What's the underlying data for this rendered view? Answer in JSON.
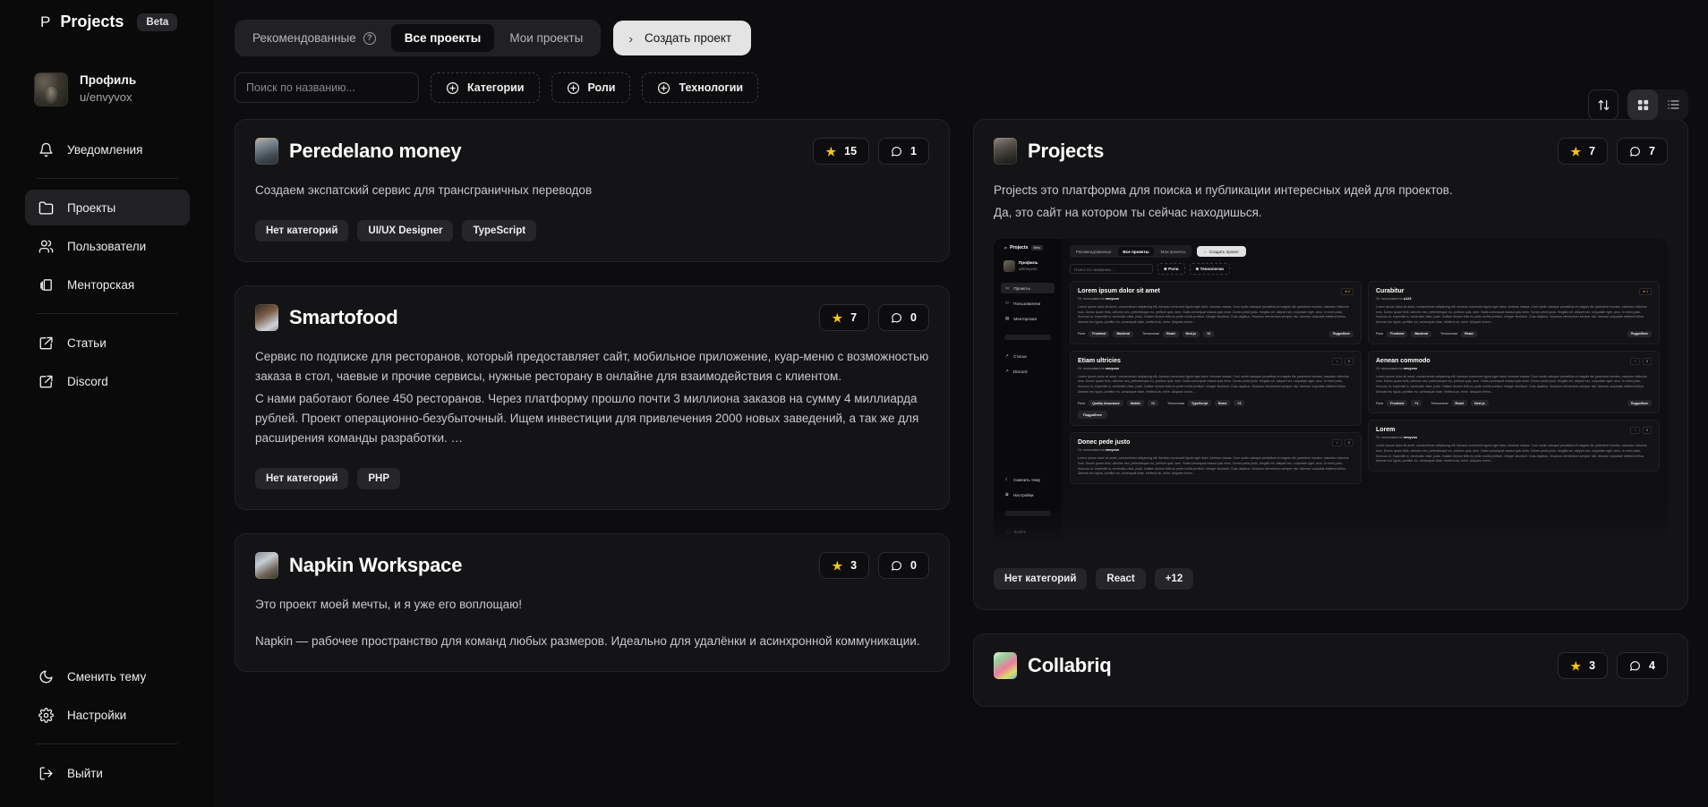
{
  "sidebar": {
    "brand": {
      "mark": "P",
      "name": "Projects",
      "beta": "Beta"
    },
    "profile": {
      "name": "Профиль",
      "handle": "u/envyvox"
    },
    "items": [
      {
        "label": "Уведомления",
        "icon": "bell-icon"
      },
      {
        "label": "Проекты",
        "icon": "folder-icon"
      },
      {
        "label": "Пользователи",
        "icon": "users-icon"
      },
      {
        "label": "Менторская",
        "icon": "books-icon"
      },
      {
        "label": "Статьи",
        "icon": "external-link-icon"
      },
      {
        "label": "Discord",
        "icon": "external-link-icon"
      },
      {
        "label": "Сменить тему",
        "icon": "moon-icon"
      },
      {
        "label": "Настройки",
        "icon": "gear-icon"
      },
      {
        "label": "Выйти",
        "icon": "logout-icon"
      }
    ]
  },
  "topbar": {
    "tabs": [
      {
        "label": "Рекомендованные",
        "help": "?",
        "active": false
      },
      {
        "label": "Все проекты",
        "active": true
      },
      {
        "label": "Мои проекты",
        "active": false
      }
    ],
    "create_button": "Создать проект",
    "create_chevron": "›"
  },
  "filters": {
    "search_placeholder": "Поиск по названию...",
    "search_value": "",
    "chips": [
      {
        "label": "Категории",
        "icon": "plus-circle-icon"
      },
      {
        "label": "Роли",
        "icon": "plus-circle-icon"
      },
      {
        "label": "Технологии",
        "icon": "plus-circle-icon"
      }
    ]
  },
  "view_tools": {
    "sort": {
      "name": "sort-icon",
      "glyph": "↑↓"
    },
    "grid": {
      "name": "grid-view-icon",
      "active": true
    },
    "list": {
      "name": "list-view-icon",
      "active": false
    }
  },
  "left_column": [
    {
      "title": "Peredelano money",
      "avatar": "av-pm",
      "stars": "15",
      "comments": "1",
      "description": [
        "Создаем экспатский сервис для трансграничных переводов"
      ],
      "tags": [
        "Нет категорий",
        "UI/UX Designer",
        "TypeScript"
      ]
    },
    {
      "title": "Smartofood",
      "avatar": "av-sf",
      "stars": "7",
      "comments": "0",
      "description": [
        "Сервис по подписке для ресторанов, который предоставляет сайт, мобильное приложение, куар-меню с возможностью заказа в стол, чаевые и прочие сервисы, нужные ресторану в онлайне для взаимодействия с клиентом.",
        "С нами работают более 450 ресторанов. Через платформу прошло почти 3 миллиона заказов на сумму 4 миллиарда рублей. Проект операционно-безубыточный. Ищем инвестиции для привлечения 2000 новых заведений, а так же для расширения команды разработки. …"
      ],
      "tags": [
        "Нет категорий",
        "PHP"
      ]
    },
    {
      "title": "Napkin Workspace",
      "avatar": "av-np",
      "stars": "3",
      "comments": "0",
      "description": [
        "Это проект моей мечты, и я уже его воплощаю!",
        "Napkin — рабочее пространство для команд любых размеров. Идеально для удалёнки и асинхронной коммуникации."
      ],
      "tags": []
    }
  ],
  "right_column": [
    {
      "title": "Projects",
      "avatar": "av-pj",
      "stars": "7",
      "comments": "7",
      "description": [
        "Projects это платформа для поиска и публикации интересных идей для проектов.",
        "Да, это сайт на котором ты сейчас находишься."
      ],
      "tags": [
        "Нет категорий",
        "React",
        "+12"
      ],
      "has_preview": true
    },
    {
      "title": "Collabriq",
      "avatar": "av-cb",
      "stars": "3",
      "comments": "4",
      "description": [],
      "tags": []
    }
  ],
  "preview": {
    "brand": {
      "mark": "P",
      "name": "Projects",
      "beta": "Beta"
    },
    "profile": {
      "name": "Профиль",
      "handle": "u/envyvox"
    },
    "nav": [
      "Проекты",
      "Пользователи",
      "Менторская",
      "Статьи",
      "Discord"
    ],
    "footer_nav": [
      "Сменить тему",
      "Настройки",
      "Выйти"
    ],
    "tabs": [
      "Рекомендованные",
      "Все проекты",
      "Мои проекты"
    ],
    "create_button": "Создать проект",
    "search_placeholder": "Поиск по названию...",
    "filter_chips": [
      "Роли",
      "Технологии"
    ],
    "lorem_short": "Lorem ipsum dolor sit amet, consectetuer adipiscing elit. Aenean commodo ligula eget dolor. Aenean massa. Cum sociis natoque penatibus et magnis dis parturient montes, nascetur ridiculus mus. Donec quam felis, ultricies nec, pellentesque eu, pretium quis, sem. Nulla consequat massa quis enim. Donec pede justo, fringilla vel, aliquet nec, vulputate eget, arcu. In enim justo, rhoncus ut, imperdiet a, venenatis vitae, justo. Nullam dictum felis eu pede mollis pretium. Integer tincidunt. Cras dapibus. Vivamus elementum semper nisi. Aenean vulputate eleifend tellus. Aenean leo ligula, porttitor eu, consequat vitae, eleifend ac, enim. Aliquam lorem...",
    "byline_prefix": "От пользователя",
    "byline_user": "envyvox",
    "details_button": "Подробнее",
    "cards": [
      {
        "title": "Lorem ipsum dolor sit amet",
        "stars": "2",
        "roles_label": "Роли",
        "roles": [
          "Frontend",
          "Backend"
        ],
        "tech_label": "Технологии",
        "tech": [
          "React",
          "Next.js",
          "+2"
        ]
      },
      {
        "title": "Curabitur",
        "user": "u123",
        "stars": "1",
        "roles_label": "Роли",
        "roles": [
          "Frontend",
          "Backend"
        ],
        "tech_label": "Технологии",
        "tech": [
          "React"
        ]
      },
      {
        "title": "Etiam ultricies",
        "roles_label": "Роли",
        "roles": [
          "Quality Assurance",
          "Mobile",
          "+1"
        ],
        "tech_label": "Технологии",
        "tech": [
          "TypeScript",
          "React",
          "+2"
        ]
      },
      {
        "title": "Aenean commodo",
        "roles_label": "Роли",
        "roles": [
          "Frontend",
          "+1"
        ],
        "tech_label": "Технологии",
        "tech": [
          "React",
          "Next.js",
          "+1"
        ]
      },
      {
        "title": "Donec pede justo"
      },
      {
        "title": "Lorem"
      }
    ]
  },
  "colors": {
    "background": "#0a0a0a",
    "main_background": "#0d0d0f",
    "card": "#141416",
    "accent_star": "#f5c518",
    "button_light": "#e4e4e4"
  }
}
